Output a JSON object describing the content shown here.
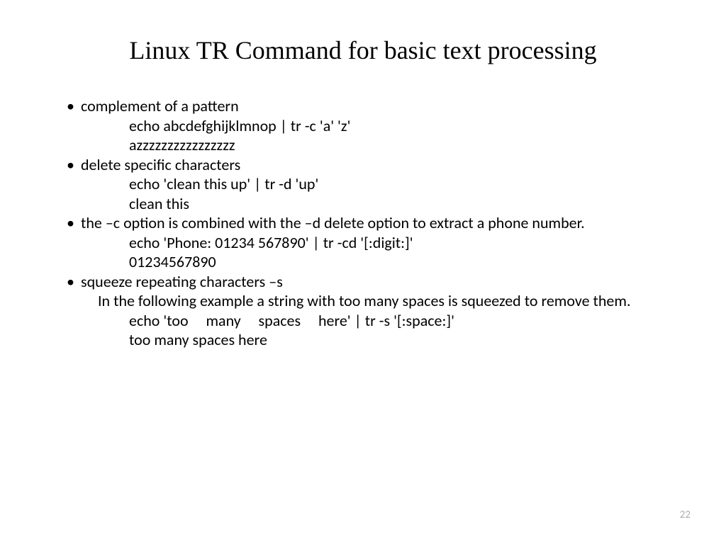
{
  "title": "Linux TR Command for basic text processing",
  "bullets": [
    {
      "heading": "complement of a pattern",
      "lines": [
        "echo abcdefghijklmnop | tr -c 'a' 'z'",
        "azzzzzzzzzzzzzzzz"
      ]
    },
    {
      "heading": "delete specific characters",
      "lines": [
        "echo 'clean this up' |  tr  -d  'up'",
        "clean this"
      ]
    },
    {
      "heading": "the –c  option is combined with the –d delete option to extract a phone number.",
      "lines": [
        "echo 'Phone: 01234 567890'  |  tr  -cd  '[:digit:]'",
        "01234567890"
      ]
    },
    {
      "heading": "squeeze repeating characters –s",
      "sub": "In the following example a string with too many spaces is squeezed to remove them.",
      "lines": [
        "echo 'too     many     spaces     here'  |  tr  -s  '[:space:]'",
        "too many spaces here"
      ]
    }
  ],
  "page_number": "22"
}
